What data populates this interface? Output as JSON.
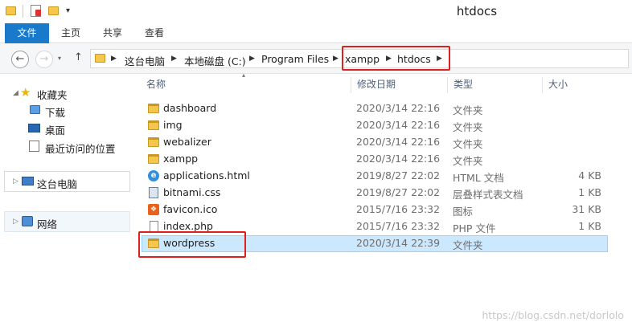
{
  "window": {
    "title": "htdocs"
  },
  "ribbon": {
    "tabs": [
      "文件",
      "主页",
      "共享",
      "查看"
    ]
  },
  "address": {
    "crumbs": [
      "这台电脑",
      "本地磁盘 (C:)",
      "Program Files",
      "xampp",
      "htdocs"
    ]
  },
  "nav": {
    "favorites": "收藏夹",
    "favorites_items": [
      "下载",
      "桌面",
      "最近访问的位置"
    ],
    "this_pc": "这台电脑",
    "network": "网络"
  },
  "columns": {
    "name": "名称",
    "date": "修改日期",
    "type": "类型",
    "size": "大小"
  },
  "files": [
    {
      "name": "dashboard",
      "date": "2020/3/14 22:16",
      "type": "文件夹",
      "size": "",
      "icon": "folder-icon"
    },
    {
      "name": "img",
      "date": "2020/3/14 22:16",
      "type": "文件夹",
      "size": "",
      "icon": "folder-icon"
    },
    {
      "name": "webalizer",
      "date": "2020/3/14 22:16",
      "type": "文件夹",
      "size": "",
      "icon": "folder-icon"
    },
    {
      "name": "xampp",
      "date": "2020/3/14 22:16",
      "type": "文件夹",
      "size": "",
      "icon": "folder-icon"
    },
    {
      "name": "applications.html",
      "date": "2019/8/27 22:02",
      "type": "HTML 文档",
      "size": "4 KB",
      "icon": "html-file-icon"
    },
    {
      "name": "bitnami.css",
      "date": "2019/8/27 22:02",
      "type": "层叠样式表文档",
      "size": "1 KB",
      "icon": "css-file-icon"
    },
    {
      "name": "favicon.ico",
      "date": "2015/7/16 23:32",
      "type": "图标",
      "size": "31 KB",
      "icon": "favicon-file-icon"
    },
    {
      "name": "index.php",
      "date": "2015/7/16 23:32",
      "type": "PHP 文件",
      "size": "1 KB",
      "icon": "php-file-icon"
    },
    {
      "name": "wordpress",
      "date": "2020/3/14 22:39",
      "type": "文件夹",
      "size": "",
      "icon": "folder-icon",
      "selected": true
    }
  ],
  "watermark": "https://blog.csdn.net/dorlolo",
  "colors": {
    "accent": "#1979ca",
    "highlight": "#e0201e",
    "selection": "#cce8ff"
  }
}
